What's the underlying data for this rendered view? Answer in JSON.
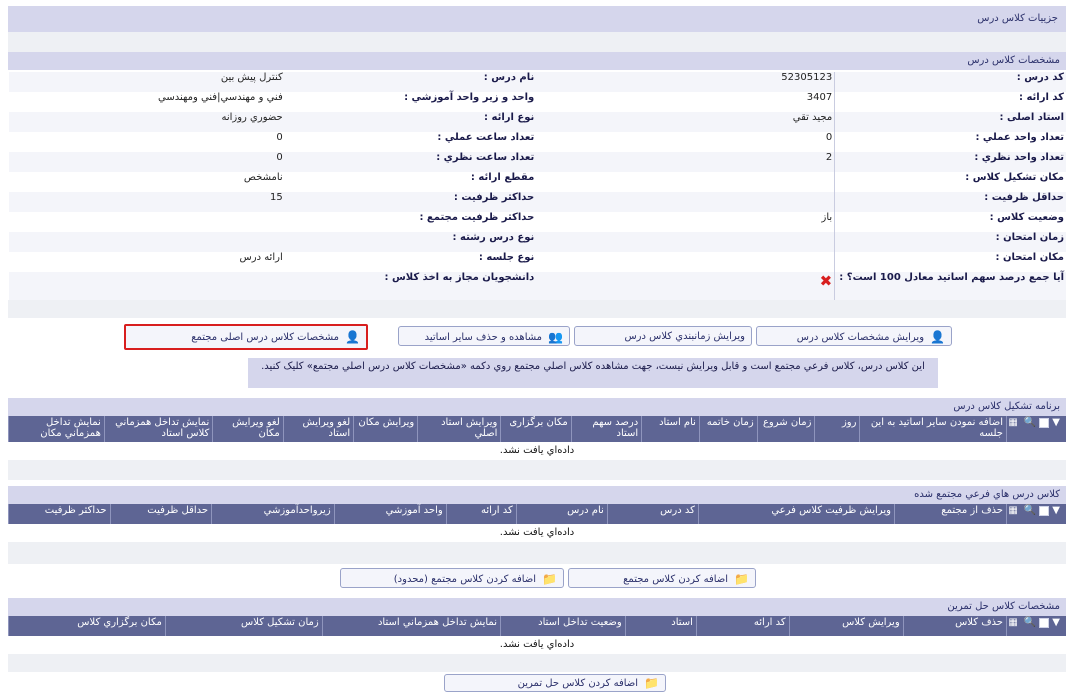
{
  "header": {
    "title": "جزییات کلاس درس"
  },
  "info_section": {
    "title": "مشخصات كلاس درس",
    "rows": [
      {
        "r_label": "کد درس :",
        "r_value": "52305123",
        "l_label": "نام درس :",
        "l_value": "کنترل پیش بین"
      },
      {
        "r_label": "كد ارائه :",
        "r_value": "3407",
        "l_label": "واحد و زير واحد آموزشي :",
        "l_value": "فني و مهندسي|فني ومهندسي"
      },
      {
        "r_label": "استاد اصلی :",
        "r_value": "مجيد تقي",
        "l_label": "نوع ارائه :",
        "l_value": "حضوري روزانه"
      },
      {
        "r_label": "تعداد واحد عملي :",
        "r_value": "0",
        "l_label": "تعداد ساعت عملي :",
        "l_value": "0"
      },
      {
        "r_label": "تعداد واحد نظري :",
        "r_value": "2",
        "l_label": "تعداد ساعت نظري :",
        "l_value": "0"
      },
      {
        "r_label": "مکان تشکیل کلاس :",
        "r_value": "",
        "l_label": "مقطع ارائه :",
        "l_value": "نامشخص"
      },
      {
        "r_label": "حداقل ظرفيت :",
        "r_value": "",
        "l_label": "حداكثر ظرفيت :",
        "l_value": "15"
      },
      {
        "r_label": "وضعيت كلاس :",
        "r_value": "باز",
        "l_label": "حداکثر ظرفیت مجتمع :",
        "l_value": ""
      },
      {
        "r_label": "زمان امتحان :",
        "r_value": "",
        "l_label": "نوع درس رشته :",
        "l_value": ""
      },
      {
        "r_label": "مكان امتحان :",
        "r_value": "",
        "l_label": "نوع جلسه :",
        "l_value": "ارائه درس"
      },
      {
        "r_label": "آيا جمع درصد سهم اساتيد معادل 100 است؟ :",
        "r_value": "",
        "l_label": "دانشجويان مجاز به اخذ كلاس :",
        "l_value": ""
      }
    ]
  },
  "action_buttons": {
    "edit_class": "ويرايش مشخصات كلاس درس",
    "edit_schedule": "ويرايش زمانبندي كلاس درس",
    "view_delete_teachers": "مشاهده و حذف ساير اساتيد",
    "main_class_spec": "مشخصات کلاس درس اصلی مجتمع"
  },
  "notice": "اين كلاس درس، كلاس فرعي مجتمع است و قابل ويرايش نيست، جهت مشاهده كلاس اصلي مجتمع روي دكمه «مشخصات كلاس درس اصلي مجتمع» كليک كنيد.",
  "schedule_section": {
    "title": "برنامه تشكيل كلاس درس",
    "columns": [
      "اضافه نمودن ساير اساتيد به اين جلسه",
      "روز",
      "زمان شروع",
      "زمان خاتمه",
      "نام استاد",
      "درصد سهم استاد",
      "مکان برگزاری",
      "ويرايش استاد اصلي",
      "ويرايش مكان",
      "لغو ويرايش استاد",
      "لغو ويرايش مكان",
      "نمايش تداخل همزماني كلاس استاد",
      "نمايش تداخل همزماني مكان"
    ],
    "empty_text": "داده‌اي يافت نشد."
  },
  "subclasses_section": {
    "title": "كلاس درس هاي فرعي مجتمع شده",
    "columns": [
      "حذف از مجتمع",
      "ويرايش ظرفيت كلاس فرعي",
      "کد درس",
      "نام درس",
      "کد ارائه",
      "واحد آموزشي",
      "زيرواحدآموزشي",
      "حداقل ظرفيت",
      "حداكثر ظرفيت"
    ],
    "empty_text": "داده‌اي يافت نشد.",
    "add_button": "اضافه كردن كلاس مجتمع",
    "add_limited_button": "اضافه كردن كلاس مجتمع (محدود)"
  },
  "exercise_section": {
    "title": "مشخصات كلاس حل تمرين",
    "columns": [
      "حذف كلاس",
      "ويرايش كلاس",
      "کد ارائه",
      "استاد",
      "وضعيت تداخل استاد",
      "نمايش تداخل همزماني استاد",
      "زمان تشكيل كلاس",
      "مكان برگزاري كلاس"
    ],
    "empty_text": "داده‌اي يافت نشد.",
    "add_button": "اضافه كردن كلاس حل تمرين"
  },
  "colors": {
    "header_bg": "#d5d6ec",
    "table_header_bg": "#5e6594",
    "highlight_border": "#d81e1e",
    "error_icon": "#d81e1e"
  }
}
